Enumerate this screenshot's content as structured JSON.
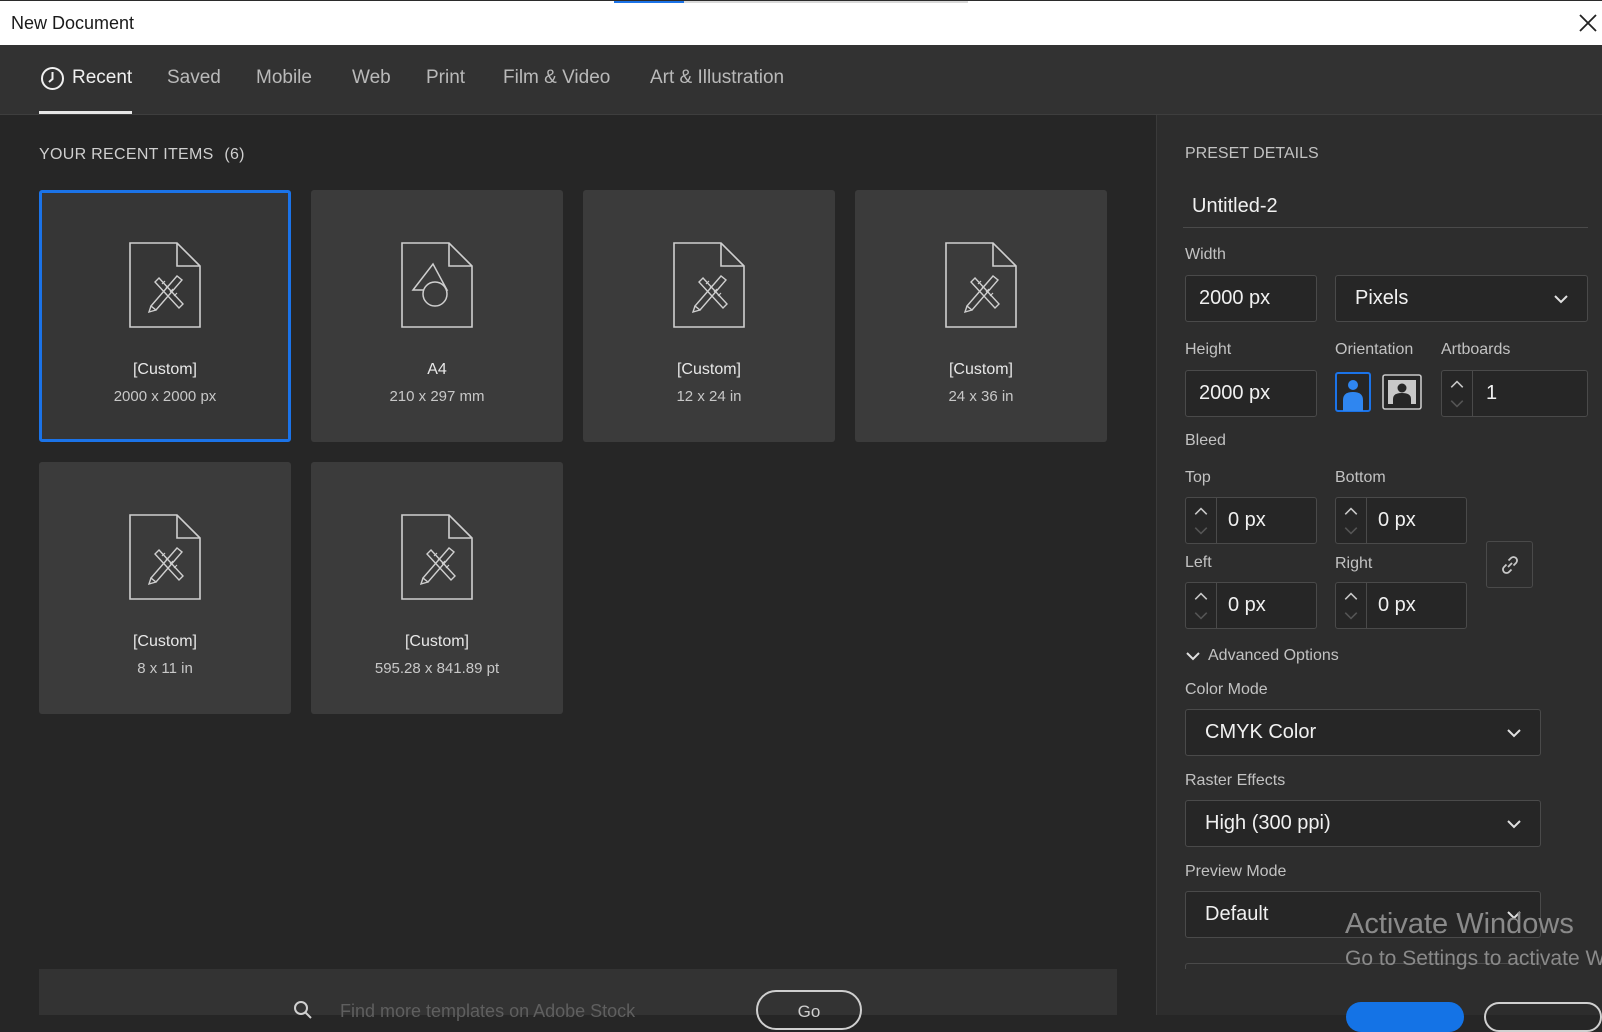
{
  "window": {
    "title": "New Document"
  },
  "tabs": [
    {
      "label": "Recent",
      "active": true
    },
    {
      "label": "Saved"
    },
    {
      "label": "Mobile"
    },
    {
      "label": "Web"
    },
    {
      "label": "Print"
    },
    {
      "label": "Film & Video"
    },
    {
      "label": "Art & Illustration"
    }
  ],
  "recent": {
    "heading": "YOUR RECENT ITEMS",
    "count": "(6)",
    "items": [
      {
        "name": "[Custom]",
        "dims": "2000 x 2000 px",
        "icon": "art-document-icon",
        "selected": true
      },
      {
        "name": "A4",
        "dims": "210 x 297 mm",
        "icon": "shapes-document-icon"
      },
      {
        "name": "[Custom]",
        "dims": "12 x 24 in",
        "icon": "art-document-icon"
      },
      {
        "name": "[Custom]",
        "dims": "24 x 36 in",
        "icon": "art-document-icon"
      },
      {
        "name": "[Custom]",
        "dims": "8 x 11 in",
        "icon": "art-document-icon"
      },
      {
        "name": "[Custom]",
        "dims": "595.28 x 841.89 pt",
        "icon": "art-document-icon"
      }
    ]
  },
  "search": {
    "placeholder": "Find more templates on Adobe Stock",
    "go_label": "Go"
  },
  "preset": {
    "heading": "PRESET DETAILS",
    "name": "Untitled-2",
    "width_label": "Width",
    "width": "2000 px",
    "units": "Pixels",
    "height_label": "Height",
    "height": "2000 px",
    "orientation_label": "Orientation",
    "orientation": "portrait",
    "artboards_label": "Artboards",
    "artboards": "1",
    "bleed_label": "Bleed",
    "bleed": {
      "top_label": "Top",
      "top": "0 px",
      "bottom_label": "Bottom",
      "bottom": "0 px",
      "left_label": "Left",
      "left": "0 px",
      "right_label": "Right",
      "right": "0 px"
    },
    "advanced_label": "Advanced Options",
    "color_mode_label": "Color Mode",
    "color_mode": "CMYK Color",
    "raster_label": "Raster Effects",
    "raster": "High (300 ppi)",
    "preview_label": "Preview Mode",
    "preview": "Default"
  },
  "watermark": {
    "line1": "Activate Windows",
    "line2": "Go to Settings to activate Windows."
  },
  "colors": {
    "accent": "#1473e6",
    "selected_border": "#1b73e8",
    "panel": "#2d2d2d",
    "background": "#262626"
  }
}
